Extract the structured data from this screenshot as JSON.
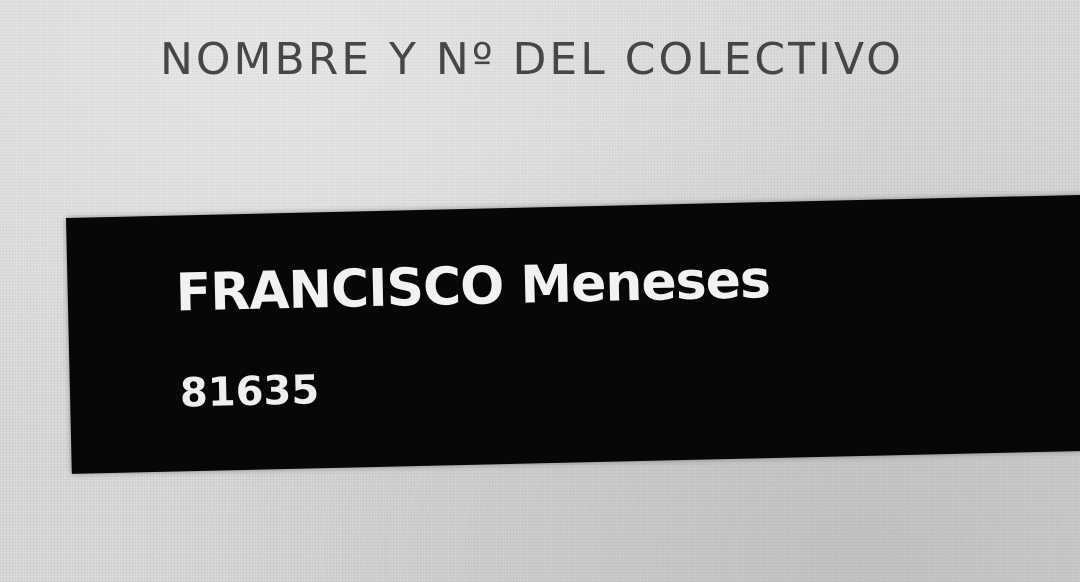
{
  "header": {
    "label": "NOMBRE Y Nº DEL COLECTIVO"
  },
  "collective": {
    "name": "FRANCISCO Meneses",
    "number": "81635"
  }
}
